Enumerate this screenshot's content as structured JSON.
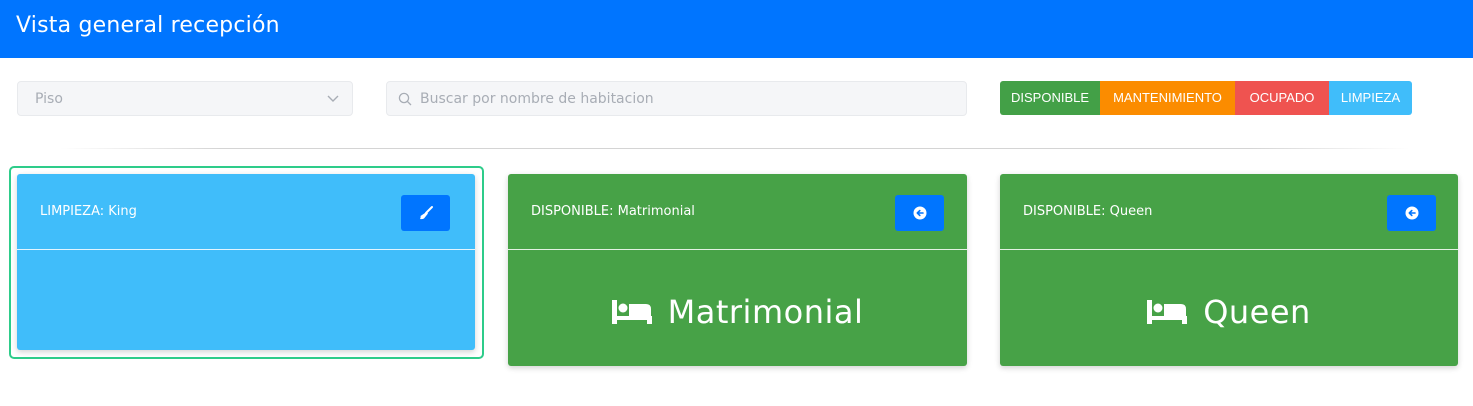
{
  "header": {
    "title": "Vista general recepción"
  },
  "filters": {
    "floor_select": {
      "value": "Piso"
    },
    "search": {
      "placeholder": "Buscar por nombre de habitacion"
    }
  },
  "legend": [
    {
      "label": "DISPONIBLE",
      "color": "#43a047"
    },
    {
      "label": "MANTENIMIENTO",
      "color": "#fb8c00"
    },
    {
      "label": "OCUPADO",
      "color": "#ef5350"
    },
    {
      "label": "LIMPIEZA",
      "color": "#40bdfa"
    }
  ],
  "rooms": [
    {
      "title": "LIMPIEZA: King",
      "name": "",
      "status_color": "#40bdfa",
      "icon": "broom-icon",
      "selected": true
    },
    {
      "title": "DISPONIBLE: Matrimonial",
      "name": "Matrimonial",
      "status_color": "#47a247",
      "icon": "arrow-circle-left-icon",
      "room_icon": "bed-icon"
    },
    {
      "title": "DISPONIBLE: Queen",
      "name": "Queen",
      "status_color": "#47a247",
      "icon": "arrow-circle-left-icon",
      "room_icon": "bed-icon"
    }
  ]
}
